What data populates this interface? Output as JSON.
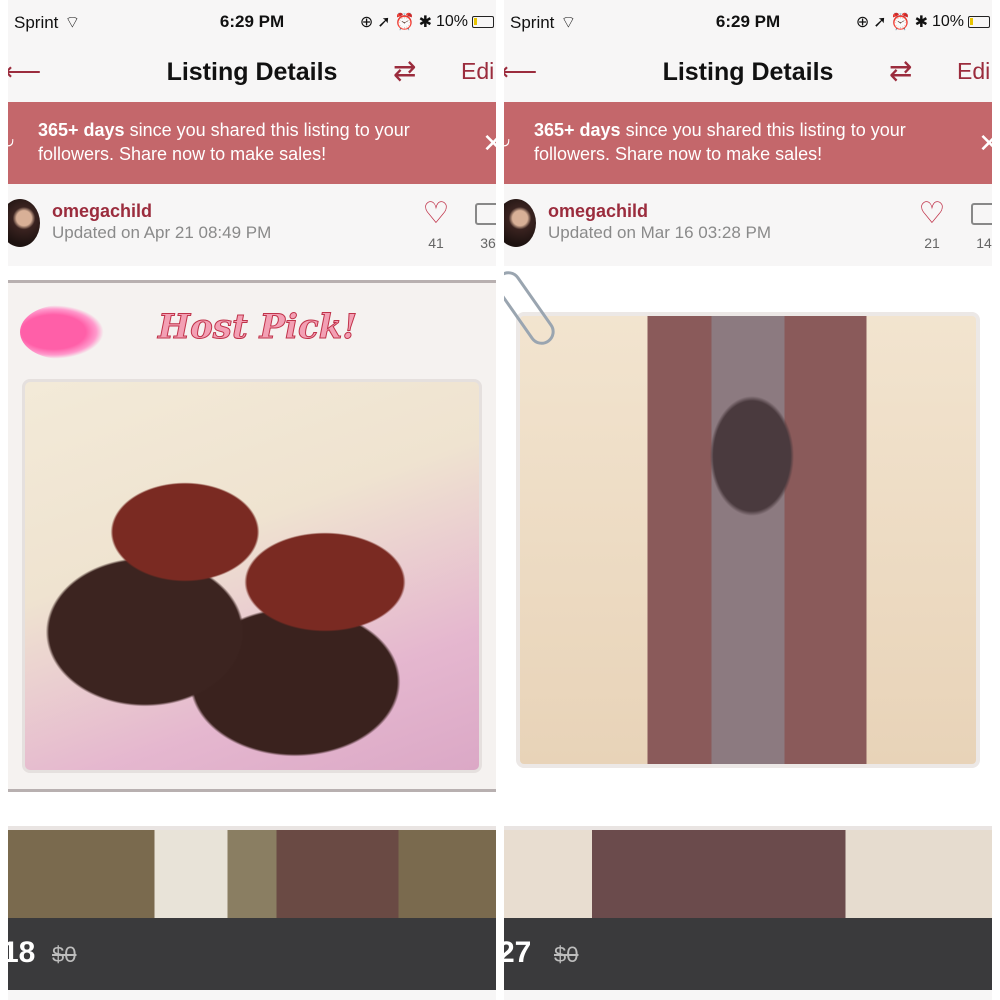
{
  "left": {
    "status": {
      "carrier": "Sprint",
      "time": "6:29 PM",
      "battery": "10%"
    },
    "nav": {
      "back_icon": "back-arrow-icon",
      "title": "Listing Details",
      "share_icon": "share-icon",
      "edit": "Edi"
    },
    "banner": {
      "highlight": "365+ days",
      "message": " since you shared this listing to your followers. Share now to make sales!"
    },
    "seller": {
      "username": "omegachild",
      "updated": "Updated on Apr 21 08:49 PM",
      "likes": "41",
      "comments": "36"
    },
    "photo": {
      "caption": "Host Pick!"
    },
    "price": {
      "current": "18",
      "original": "$0"
    }
  },
  "right": {
    "status": {
      "carrier": "Sprint",
      "time": "6:29 PM",
      "battery": "10%"
    },
    "nav": {
      "back_icon": "back-arrow-icon",
      "title": "Listing Details",
      "share_icon": "share-icon",
      "edit": "Edi"
    },
    "banner": {
      "highlight": "365+ days",
      "message": " since you shared this listing to your followers. Share now to make sales!"
    },
    "seller": {
      "username": "omegachild",
      "updated": "Updated on Mar 16 03:28 PM",
      "likes": "21",
      "comments": "14"
    },
    "price": {
      "current": "27",
      "original": "$0"
    }
  },
  "colors": {
    "accent": "#9b2c3d",
    "banner": "#c4676b",
    "price_bar": "#3a3a3c"
  }
}
